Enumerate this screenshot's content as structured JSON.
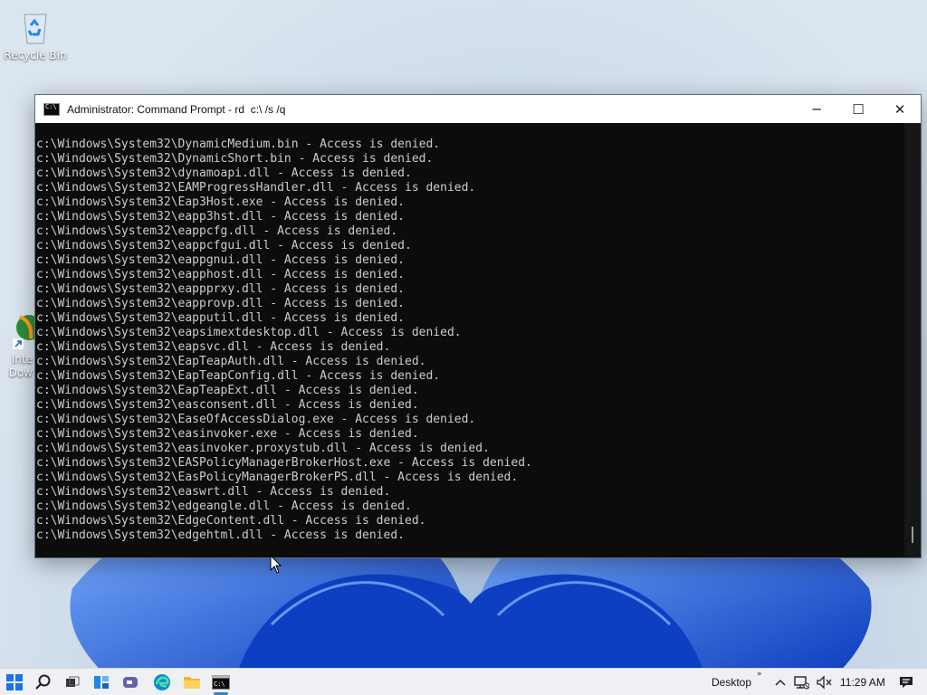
{
  "desktop": {
    "icons": [
      {
        "label": "Recycle Bin"
      },
      {
        "label": "Inte\nDow"
      }
    ]
  },
  "window": {
    "title": "Administrator: Command Prompt - rd  c:\\ /s /q",
    "minimize_label": "─",
    "maximize_label": "☐",
    "close_label": "✕"
  },
  "console": {
    "lines": [
      "c:\\Windows\\System32\\DynamicMedium.bin - Access is denied.",
      "c:\\Windows\\System32\\DynamicShort.bin - Access is denied.",
      "c:\\Windows\\System32\\dynamoapi.dll - Access is denied.",
      "c:\\Windows\\System32\\EAMProgressHandler.dll - Access is denied.",
      "c:\\Windows\\System32\\Eap3Host.exe - Access is denied.",
      "c:\\Windows\\System32\\eapp3hst.dll - Access is denied.",
      "c:\\Windows\\System32\\eappcfg.dll - Access is denied.",
      "c:\\Windows\\System32\\eappcfgui.dll - Access is denied.",
      "c:\\Windows\\System32\\eappgnui.dll - Access is denied.",
      "c:\\Windows\\System32\\eapphost.dll - Access is denied.",
      "c:\\Windows\\System32\\eappprxy.dll - Access is denied.",
      "c:\\Windows\\System32\\eapprovp.dll - Access is denied.",
      "c:\\Windows\\System32\\eapputil.dll - Access is denied.",
      "c:\\Windows\\System32\\eapsimextdesktop.dll - Access is denied.",
      "c:\\Windows\\System32\\eapsvc.dll - Access is denied.",
      "c:\\Windows\\System32\\EapTeapAuth.dll - Access is denied.",
      "c:\\Windows\\System32\\EapTeapConfig.dll - Access is denied.",
      "c:\\Windows\\System32\\EapTeapExt.dll - Access is denied.",
      "c:\\Windows\\System32\\easconsent.dll - Access is denied.",
      "c:\\Windows\\System32\\EaseOfAccessDialog.exe - Access is denied.",
      "c:\\Windows\\System32\\easinvoker.exe - Access is denied.",
      "c:\\Windows\\System32\\easinvoker.proxystub.dll - Access is denied.",
      "c:\\Windows\\System32\\EASPolicyManagerBrokerHost.exe - Access is denied.",
      "c:\\Windows\\System32\\EasPolicyManagerBrokerPS.dll - Access is denied.",
      "c:\\Windows\\System32\\easwrt.dll - Access is denied.",
      "c:\\Windows\\System32\\edgeangle.dll - Access is denied.",
      "c:\\Windows\\System32\\EdgeContent.dll - Access is denied.",
      "c:\\Windows\\System32\\edgehtml.dll - Access is denied."
    ]
  },
  "taskbar": {
    "icons": [
      "start-icon",
      "search-icon",
      "task-view-icon",
      "widgets-icon",
      "chat-icon",
      "edge-icon",
      "file-explorer-icon",
      "command-prompt-icon"
    ],
    "desktop_label": "Desktop",
    "more_label": "»",
    "clock": "11:29 AM"
  },
  "colors": {
    "console_bg": "#0c0c0c",
    "console_text": "#cccccc",
    "taskbar_bg": "#eef0f3",
    "accent": "#3b82c4"
  }
}
